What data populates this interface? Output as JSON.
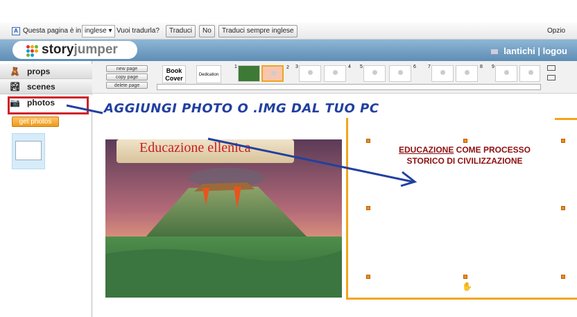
{
  "translate_bar": {
    "prefix": "Questa pagina è in",
    "language": "inglese",
    "question": "Vuoi tradurla?",
    "translate_btn": "Traduci",
    "no_btn": "No",
    "always_btn": "Traduci sempre inglese",
    "options": "Opzio"
  },
  "header": {
    "logo_story": "story",
    "logo_jumper": "jumper",
    "user": "lantichi | logou"
  },
  "sidebar": {
    "tabs": [
      {
        "label": "props",
        "icon": "props-icon"
      },
      {
        "label": "scenes",
        "icon": "scenes-icon"
      },
      {
        "label": "photos",
        "icon": "camera-icon"
      }
    ],
    "get_photos": "get photos"
  },
  "toolbar": {
    "new_page": "new page",
    "copy_page": "copy page",
    "delete_page": "delete page",
    "book_cover": "Book Cover",
    "dedication": "Dedication",
    "page_numbers": [
      "1",
      "2",
      "3",
      "4",
      "5",
      "6",
      "7",
      "8",
      "9"
    ]
  },
  "annotation": "AGGIUNGI PHOTO O .IMG DAL TUO PC",
  "left_page": {
    "title": "Educazione ellenica"
  },
  "right_page": {
    "line1_underlined": "EDUCAZIONE",
    "line1_rest": " COME PROCESSO",
    "line2": "STORICO DI CIVILIZZAZIONE"
  },
  "colors": {
    "accent_orange": "#f2a51a",
    "annotation_blue": "#2140a0",
    "title_red": "#c81f1f",
    "header_blue": "#6f9ac0"
  }
}
